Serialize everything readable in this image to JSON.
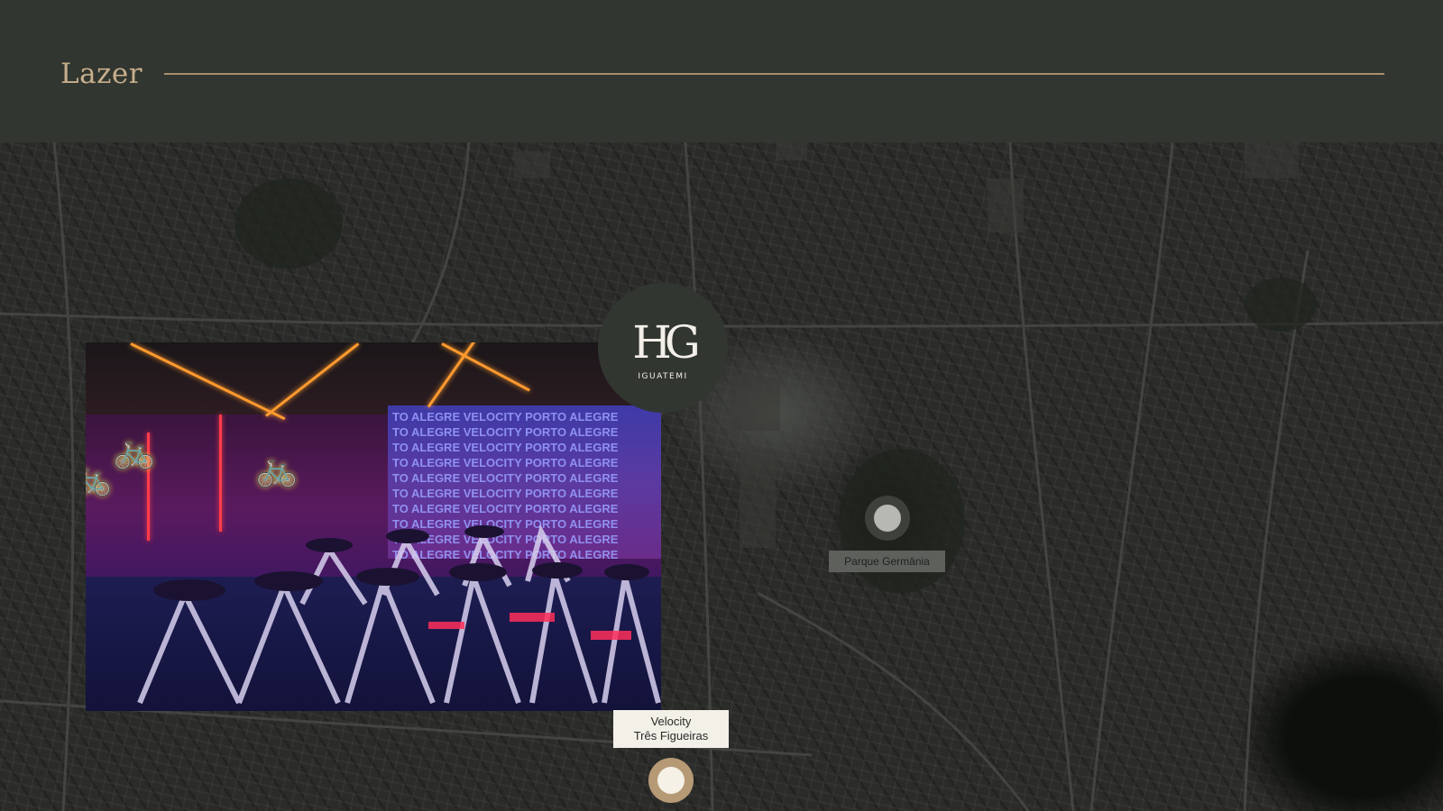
{
  "header": {
    "title": "Lazer"
  },
  "logo": {
    "mark": "HG",
    "subtitle": "IGUATEMI"
  },
  "photo": {
    "wall_text": [
      "TO ALEGRE VELOCITY PORTO ALEGRE",
      "TO ALEGRE VELOCITY PORTO ALEGRE",
      "TO ALEGRE VELOCITY PORTO ALEGRE",
      "TO ALEGRE VELOCITY PORTO ALEGRE",
      "TO ALEGRE VELOCITY PORTO ALEGRE",
      "TO ALEGRE VELOCITY PORTO ALEGRE",
      "TO ALEGRE VELOCITY PORTO ALEGRE",
      "TO ALEGRE VELOCITY PORTO ALEGRE",
      "TO ALEGRE VELOCITY PORTO ALEGRE",
      "TO ALEGRE VELOCITY PORTO ALEGRE"
    ]
  },
  "places": {
    "park": {
      "label": "Parque Germânia"
    },
    "velocity": {
      "line1": "Velocity",
      "line2": "Três Figueiras"
    }
  },
  "colors": {
    "header_bg": "#323630",
    "accent_gold": "#c7ae8c",
    "pin_gold": "#b69a76"
  }
}
